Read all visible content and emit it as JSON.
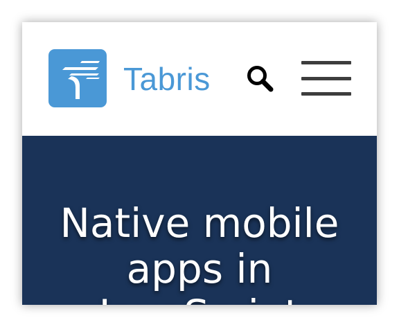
{
  "header": {
    "brand_name": "Tabris",
    "logo_icon": "tabris-logo-icon",
    "search_icon": "search-icon",
    "menu_icon": "hamburger-menu-icon"
  },
  "hero": {
    "title": "Native mobile apps in JavaScript"
  },
  "colors": {
    "brand_blue": "#4a98d6",
    "hero_background": "#1a3358",
    "icon_dark": "#3d3d3d"
  }
}
